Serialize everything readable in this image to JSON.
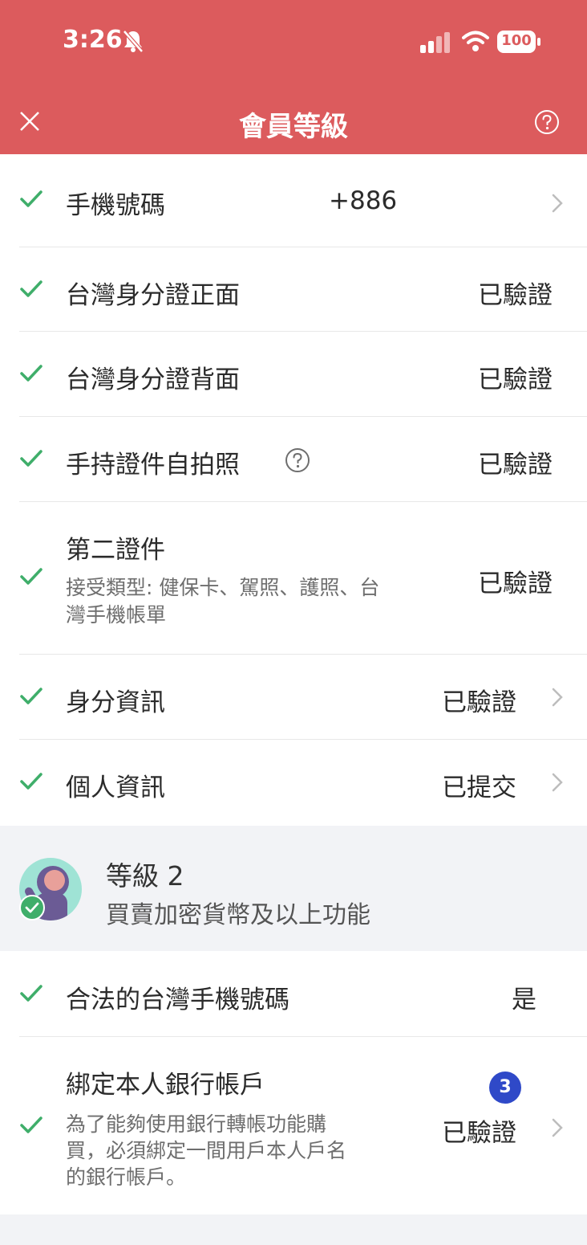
{
  "status_bar": {
    "time": "3:26",
    "battery": "100"
  },
  "header": {
    "title": "會員等級"
  },
  "rows": [
    {
      "label": "手機號碼",
      "value": "+886"
    },
    {
      "label": "台灣身分證正面",
      "value": "已驗證"
    },
    {
      "label": "台灣身分證背面",
      "value": "已驗證"
    },
    {
      "label": "手持證件自拍照",
      "value": "已驗證"
    },
    {
      "label": "第二證件",
      "sub": "接受類型: 健保卡、駕照、護照、台灣手機帳單",
      "sub_line1": "接受類型: 健保卡、駕照、護照、台",
      "sub_line2": "灣手機帳單",
      "value": "已驗證"
    },
    {
      "label": "身分資訊",
      "value": "已驗證"
    },
    {
      "label": "個人資訊",
      "value": "已提交"
    }
  ],
  "level": {
    "title": "等級 2",
    "subtitle": "買賣加密貨幣及以上功能"
  },
  "level_rows": [
    {
      "label": "合法的台灣手機號碼",
      "value": "是"
    },
    {
      "label": "綁定本人銀行帳戶",
      "sub_line1": "為了能夠使用銀行轉帳功能購",
      "sub_line2": "買，必須綁定一間用戶本人戶名",
      "sub_line3": "的銀行帳戶。",
      "value": "已驗證",
      "badge": "3"
    }
  ],
  "colors": {
    "header": "#dc5b5d",
    "check": "#3fae6a",
    "badge": "#2f49c8"
  }
}
